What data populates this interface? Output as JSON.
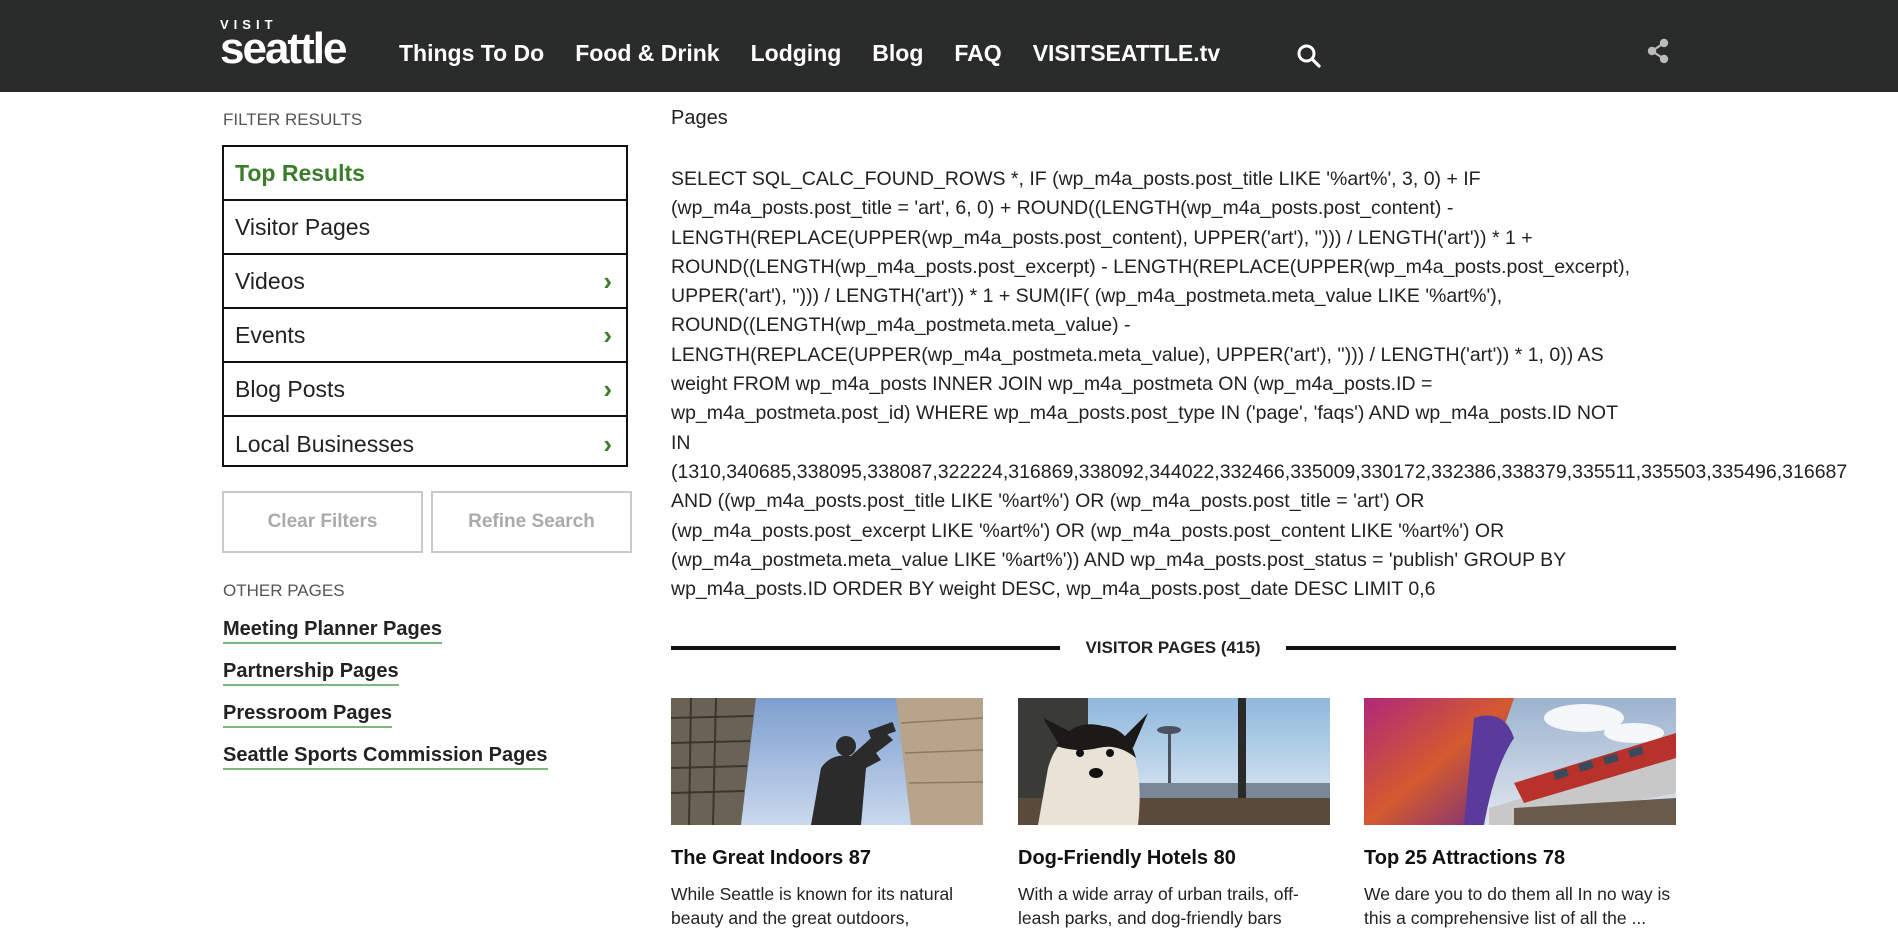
{
  "header": {
    "logo_small": "VISIT",
    "logo_big": "seattle",
    "nav": [
      "Things To Do",
      "Food & Drink",
      "Lodging",
      "Blog",
      "FAQ",
      "VISITSEATTLE.tv"
    ],
    "search_icon": "search-icon",
    "share_icon": "share-icon"
  },
  "sidebar": {
    "filter_heading": "FILTER RESULTS",
    "filters": [
      {
        "label": "Top Results",
        "active": true,
        "chevron": false
      },
      {
        "label": "Visitor Pages",
        "active": false,
        "chevron": false
      },
      {
        "label": "Videos",
        "active": false,
        "chevron": true
      },
      {
        "label": "Events",
        "active": false,
        "chevron": true
      },
      {
        "label": "Blog Posts",
        "active": false,
        "chevron": true
      },
      {
        "label": "Local Businesses",
        "active": false,
        "chevron": true
      }
    ],
    "clear_label": "Clear Filters",
    "refine_label": "Refine Search",
    "other_heading": "OTHER PAGES",
    "other_links": [
      "Meeting Planner Pages",
      "Partnership Pages",
      "Pressroom Pages",
      "Seattle Sports Commission Pages"
    ]
  },
  "main": {
    "pages_title": "Pages",
    "sql_lines": [
      "SELECT SQL_CALC_FOUND_ROWS *, IF (wp_m4a_posts.post_title LIKE '%art%', 3, 0) + IF",
      "(wp_m4a_posts.post_title = 'art', 6, 0) + ROUND((LENGTH(wp_m4a_posts.post_content) -",
      "LENGTH(REPLACE(UPPER(wp_m4a_posts.post_content), UPPER('art'), ''))) / LENGTH('art')) * 1 +",
      "ROUND((LENGTH(wp_m4a_posts.post_excerpt) - LENGTH(REPLACE(UPPER(wp_m4a_posts.post_excerpt),",
      "UPPER('art'), ''))) / LENGTH('art')) * 1 + SUM(IF( (wp_m4a_postmeta.meta_value LIKE '%art%'),",
      "ROUND((LENGTH(wp_m4a_postmeta.meta_value) -",
      "LENGTH(REPLACE(UPPER(wp_m4a_postmeta.meta_value), UPPER('art'), ''))) / LENGTH('art')) * 1, 0)) AS",
      "weight FROM wp_m4a_posts INNER JOIN wp_m4a_postmeta ON (wp_m4a_posts.ID =",
      "wp_m4a_postmeta.post_id) WHERE wp_m4a_posts.post_type IN ('page', 'faqs') AND wp_m4a_posts.ID NOT",
      "IN",
      "(1310,340685,338095,338087,322224,316869,338092,344022,332466,335009,330172,332386,338379,335511,335503,335496,316687",
      "AND ((wp_m4a_posts.post_title LIKE '%art%') OR (wp_m4a_posts.post_title = 'art') OR",
      "(wp_m4a_posts.post_excerpt LIKE '%art%') OR (wp_m4a_posts.post_content LIKE '%art%') OR",
      "(wp_m4a_postmeta.meta_value LIKE '%art%')) AND wp_m4a_posts.post_status = 'publish' GROUP BY",
      "wp_m4a_posts.ID ORDER BY weight DESC, wp_m4a_posts.post_date DESC LIMIT 0,6"
    ],
    "section_title": "VISITOR PAGES (415)",
    "cards": [
      {
        "title": "The Great Indoors 87",
        "desc": "While Seattle is known for its natural beauty and the great outdoors,"
      },
      {
        "title": "Dog-Friendly Hotels 80",
        "desc": "With a wide array of urban trails, off-leash parks, and dog-friendly bars"
      },
      {
        "title": "Top 25 Attractions 78",
        "desc": "We dare you to do them all In no way is this a comprehensive list of all the ..."
      }
    ]
  },
  "colors": {
    "header_bg": "#2a2c2b",
    "accent_green": "#3a7d2b",
    "link_underline": "#7fb77e"
  }
}
